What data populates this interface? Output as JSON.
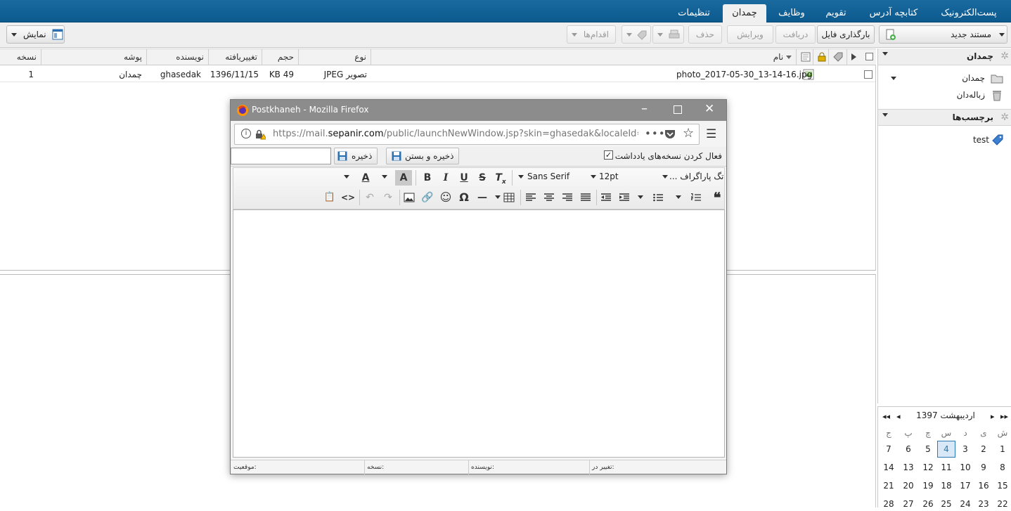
{
  "tabs": [
    {
      "label": "پست‌الکترونیک"
    },
    {
      "label": "کتابچه آدرس"
    },
    {
      "label": "تقویم"
    },
    {
      "label": "وظایف"
    },
    {
      "label": "چمدان",
      "active": true
    },
    {
      "label": "تنظیمات"
    }
  ],
  "toolbar": {
    "new_doc": "مستند جدید",
    "upload": "بارگذاری فایل",
    "receive": "دریافت",
    "edit": "ویرایش",
    "delete": "حذف",
    "actions": "اقدام‌ها",
    "view": "نمایش"
  },
  "list": {
    "columns": {
      "name": "نام",
      "type": "نوع",
      "size": "حجم",
      "modified": "تغییریافته",
      "author": "نویسنده",
      "folder": "پوشه",
      "version": "نسخه"
    },
    "rows": [
      {
        "name": "photo_2017-05-30_13-14-16.jpg",
        "type": "JPEG تصویر",
        "size": "KB 49",
        "modified": "1396/11/15",
        "author": "ghasedak",
        "folder": "چمدان",
        "version": "1"
      }
    ]
  },
  "sidebar": {
    "section_briefcase": "چمدان",
    "items": [
      {
        "label": "چمدان",
        "icon": "folder-icon"
      },
      {
        "label": "زباله‌دان",
        "icon": "trash-icon"
      }
    ],
    "section_tags": "برچسب‌ها",
    "tags": [
      {
        "label": "test",
        "icon": "tag-icon"
      }
    ]
  },
  "calendar": {
    "month": "اردیبهشت 1397",
    "weekdays": [
      "ش",
      "ی",
      "د",
      "س",
      "چ",
      "پ",
      "ج"
    ],
    "weeks": [
      [
        "1",
        "2",
        "3",
        "4",
        "5",
        "6",
        "7"
      ],
      [
        "8",
        "9",
        "10",
        "11",
        "12",
        "13",
        "14"
      ],
      [
        "15",
        "16",
        "17",
        "18",
        "19",
        "20",
        "21"
      ],
      [
        "22",
        "23",
        "24",
        "25",
        "26",
        "27",
        "28"
      ]
    ],
    "today": "4"
  },
  "popup": {
    "title": "Postkhaneh - Mozilla Firefox",
    "url_prefix": "https://mail.",
    "url_domain": "sepanir.com",
    "url_rest": "/public/launchNewWindow.jsp?skin=ghasedak&localeId=fa_IR",
    "save": "ذخیره",
    "save_close": "ذخیره و بستن",
    "enable_versions": "فعال کردن نسخه‌های یادداشت",
    "enable_versions_checked": true,
    "name_value": "",
    "editor": {
      "font_family": "Sans Serif",
      "font_size": "12pt",
      "paragraph": "... تگ پاراگراف"
    },
    "footer": {
      "location": "موقعیت:",
      "version": "نسخه:",
      "author": "نویسنده:",
      "modified": "تغییر در:"
    }
  },
  "colors": {
    "topbar": "#0c5a8e",
    "calendar_today": "#2a78b4"
  }
}
